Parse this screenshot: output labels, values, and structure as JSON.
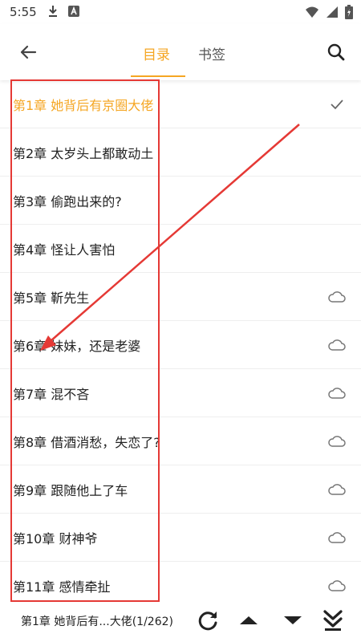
{
  "status_bar": {
    "time": "5:55",
    "left_icons": [
      "download-icon",
      "text-app-icon"
    ],
    "right_icons": [
      "wifi-icon",
      "signal-icon",
      "battery-icon"
    ]
  },
  "header": {
    "tabs": [
      {
        "label": "目录",
        "active": true
      },
      {
        "label": "书签",
        "active": false
      }
    ],
    "accent_color": "#f5a623"
  },
  "chapters": [
    {
      "title": "第1章 她背后有京圈大佬",
      "current": true,
      "icon": "check-icon"
    },
    {
      "title": "第2章 太岁头上都敢动土",
      "current": false,
      "icon": ""
    },
    {
      "title": "第3章 偷跑出来的?",
      "current": false,
      "icon": ""
    },
    {
      "title": "第4章 怪让人害怕",
      "current": false,
      "icon": ""
    },
    {
      "title": "第5章 靳先生",
      "current": false,
      "icon": "cloud-icon"
    },
    {
      "title": "第6章 妹妹，还是老婆",
      "current": false,
      "icon": "cloud-icon"
    },
    {
      "title": "第7章 混不吝",
      "current": false,
      "icon": "cloud-icon"
    },
    {
      "title": "第8章 借酒消愁，失恋了?",
      "current": false,
      "icon": "cloud-icon"
    },
    {
      "title": "第9章 跟随他上了车",
      "current": false,
      "icon": "cloud-icon"
    },
    {
      "title": "第10章 财神爷",
      "current": false,
      "icon": "cloud-icon"
    },
    {
      "title": "第11章 感情牵扯",
      "current": false,
      "icon": "cloud-icon"
    }
  ],
  "bottom_bar": {
    "current_chapter": "第1章 她背后有...大佬(1/262)",
    "buttons": [
      "refresh-icon",
      "scroll-up-icon",
      "scroll-down-icon",
      "jump-to-end-icon"
    ]
  },
  "annotation": {
    "color": "#e53935"
  }
}
